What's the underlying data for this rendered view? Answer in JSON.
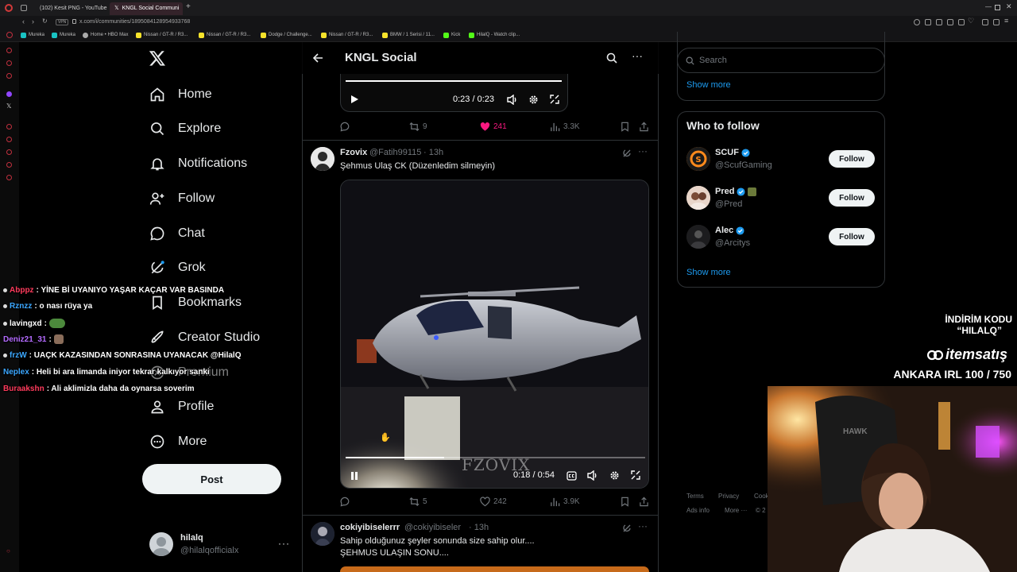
{
  "browser": {
    "tabs": [
      {
        "label": "(102) Kesit PNG - YouTube",
        "active": false
      },
      {
        "label": "KNGL Social Communi",
        "active": true
      }
    ],
    "url": "x.com/i/communities/1895084128954933768",
    "bookmarks": [
      "Mureka",
      "Mureka",
      "Home • HBO Max",
      "Nissan / GT-R / R3...",
      "Nissan / GT-R / R3...",
      "Dodge / Challenge...",
      "Nissan / GT-R / R3...",
      "BMW / 1 Serisi / 11...",
      "Kick",
      "HilalQ - Watch clip..."
    ]
  },
  "nav": {
    "items": [
      {
        "label": "Home",
        "icon": "home-icon"
      },
      {
        "label": "Explore",
        "icon": "search-icon"
      },
      {
        "label": "Notifications",
        "icon": "bell-icon"
      },
      {
        "label": "Follow",
        "icon": "person-plus-icon"
      },
      {
        "label": "Chat",
        "icon": "chat-icon"
      },
      {
        "label": "Grok",
        "icon": "grok-icon"
      },
      {
        "label": "Bookmarks",
        "icon": "bookmark-icon"
      },
      {
        "label": "Creator Studio",
        "icon": "rocket-icon"
      },
      {
        "label": "Premium",
        "icon": "x-icon"
      },
      {
        "label": "Profile",
        "icon": "person-icon"
      },
      {
        "label": "More",
        "icon": "more-circle-icon"
      }
    ],
    "post_label": "Post",
    "account": {
      "name": "hilalq",
      "handle": "@hilalqofficialx"
    }
  },
  "header": {
    "title": "KNGL Social"
  },
  "tweets": [
    {
      "video": {
        "time": "0:23 / 0:23",
        "progress": 1.0
      },
      "actions": {
        "replies": "",
        "reposts": "9",
        "likes": "241",
        "views": "3.3K",
        "liked": true
      }
    },
    {
      "name": "Fzovix",
      "handle": "@Fatih99115",
      "time": "· 13h",
      "text": "Şehmus Ulaş CK (Düzenledim silmeyin)",
      "video": {
        "time": "0:18 / 0:54",
        "progress": 0.33,
        "watermark": "FZOVIX"
      },
      "actions": {
        "replies": "",
        "reposts": "5",
        "likes": "242",
        "views": "3.9K",
        "liked": false
      }
    },
    {
      "name": "cokiyibiselerrr",
      "handle": "@cokiyibiseler",
      "time": "· 13h",
      "text_lines": [
        "Sahip olduğunuz şeyler sonunda size sahip olur....",
        "ŞEHMUS ULAŞIN SONU...."
      ]
    }
  ],
  "right": {
    "search_placeholder": "Search",
    "trending_show_more": "Show more",
    "who_to_follow": {
      "title": "Who to follow",
      "accounts": [
        {
          "name": "SCUF",
          "handle": "@ScufGaming",
          "verified": true
        },
        {
          "name": "Pred",
          "handle": "@Pred",
          "verified": true
        },
        {
          "name": "Alec",
          "handle": "@Arcitys",
          "verified": true
        }
      ],
      "follow_label": "Follow",
      "show_more": "Show more"
    },
    "footer": [
      "Terms",
      "Privacy",
      "Cookie",
      "Ads info",
      "More ···",
      "© 2"
    ]
  },
  "chat": [
    {
      "user": "Abppz",
      "color": "#ff3b5c",
      "message": ": YİNE Bİ UYANIYO YAŞAR KAÇAR VAR BASINDA"
    },
    {
      "user": "Rznzz",
      "color": "#3ba7ff",
      "message": ": o nası rüya ya"
    },
    {
      "user": "lavingxd",
      "color": "#ffffff",
      "message": ":"
    },
    {
      "user": "Deniz21_31",
      "color": "#b46bff",
      "message": ":"
    },
    {
      "user": "frzW",
      "color": "#3ba7ff",
      "message": ": UAÇK KAZASINDAN SONRASINA UYANACAK @HilalQ"
    },
    {
      "user": "Neplex",
      "color": "#3ba7ff",
      "message": ": Heli bi ara limanda iniyor tekrar kalkıyor sanki"
    },
    {
      "user": "Buraakshn",
      "color": "#ff3b5c",
      "message": ": Ali aklimizla daha da oynarsa soverim"
    }
  ],
  "overlay": {
    "promo_title": "İNDİRİM KODU",
    "promo_code": "“HILALQ”",
    "sponsor": "itemsatış",
    "goal": "ANKARA IRL 100 / 750"
  },
  "colors": {
    "x_blue": "#1d9bf0",
    "like_pink": "#f91880",
    "background": "#000000"
  }
}
